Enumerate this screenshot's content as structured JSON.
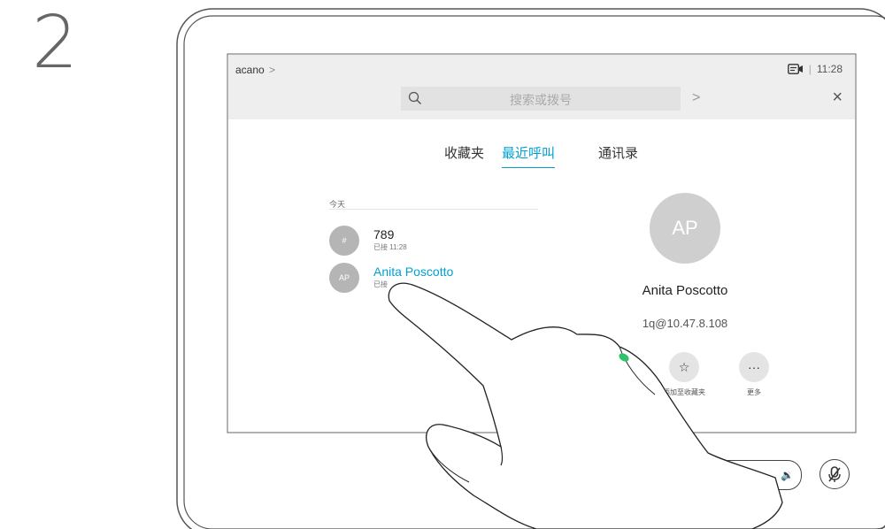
{
  "step_number": "2",
  "topbar": {
    "breadcrumb": "acano",
    "breadcrumb_chevron": ">",
    "time": "11:28",
    "separator": "|",
    "video_icon": "video-icon",
    "search_placeholder": "搜索或拨号",
    "go_arrow": ">",
    "close": "×"
  },
  "tabs": [
    {
      "label": "收藏夹",
      "active": false
    },
    {
      "label": "最近呼叫",
      "active": true
    },
    {
      "label": "通讯录",
      "active": false
    }
  ],
  "recent": {
    "section_label": "今天",
    "items": [
      {
        "avatar": "#",
        "name": "789",
        "sub": "已接 11:28"
      },
      {
        "avatar": "AP",
        "name": "Anita Poscotto",
        "sub": "已接"
      }
    ]
  },
  "contact": {
    "initials": "AP",
    "name": "Anita Poscotto",
    "address": "1q@10.47.8.108",
    "actions": [
      {
        "icon": "☆",
        "label": "添加至收藏夹"
      },
      {
        "icon": "···",
        "label": "更多"
      }
    ]
  },
  "controls": {
    "volume_icon": "🔉",
    "mute_icon": "mute-icon"
  },
  "colors": {
    "accent": "#00a0d1",
    "call_green": "#2ec26a",
    "topbar_bg": "#eeeeee"
  }
}
